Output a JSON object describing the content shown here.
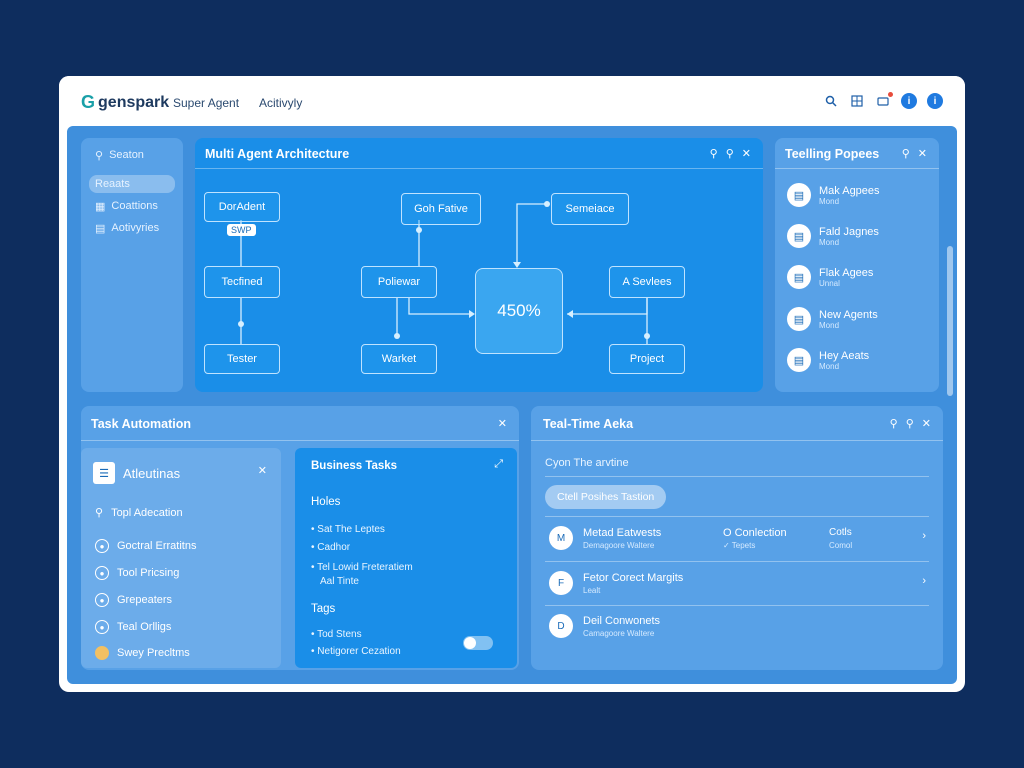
{
  "topbar": {
    "brand": "genspark",
    "brand_icon": "G",
    "nav": [
      "Super Agent",
      "Acitivyly"
    ],
    "icons": [
      "search-icon",
      "grid-icon",
      "notification-icon",
      "info-icon",
      "info-icon"
    ]
  },
  "sidebar": {
    "items": [
      {
        "label": "Seaton",
        "icon": "link-icon"
      },
      {
        "label": "Reaats",
        "icon": "none"
      },
      {
        "label": "Coattions",
        "icon": "grid-icon"
      },
      {
        "label": "Aotivyries",
        "icon": "chart-icon"
      }
    ]
  },
  "diagram": {
    "title": "Multi Agent Architecture",
    "nodes": {
      "dorradent": "DorAdent",
      "tag": "SWP",
      "tecfined": "Tecfined",
      "tester": "Tester",
      "goh_fative": "Goh Fative",
      "poliewar": "Poliewar",
      "warket": "Warket",
      "semeiace": "Semeiace",
      "a_sevlees": "A Sevlees",
      "project": "Project"
    },
    "hub_value": "450%"
  },
  "pages_panel": {
    "title": "Teelling Popees",
    "items": [
      {
        "title": "Mak Agpees",
        "sub": "Mond"
      },
      {
        "title": "Fald Jagnes",
        "sub": "Mond"
      },
      {
        "title": "Flak Agees",
        "sub": "Unnal"
      },
      {
        "title": "New Agents",
        "sub": "Mond"
      },
      {
        "title": "Hey Aeats",
        "sub": "Mond"
      }
    ]
  },
  "task_automation": {
    "title": "Task Automation",
    "attentions_title": "Atleutinas",
    "items": [
      {
        "label": "Topl Adecation",
        "icon": "search-icon"
      },
      {
        "label": "Goctral Erratitns",
        "icon": "circle-icon"
      },
      {
        "label": "Tool Pricsing",
        "icon": "circle-icon"
      },
      {
        "label": "Grepeaters",
        "icon": "circle-icon"
      },
      {
        "label": "Teal Orlligs",
        "icon": "circle-icon"
      },
      {
        "label": "Swey Precltms",
        "icon": "avatar-icon"
      }
    ],
    "business_tasks": {
      "title": "Business Tasks",
      "holes_heading": "Holes",
      "holes": [
        "Sat The Leptes",
        "Cadhor",
        "Tel Lowid Freteratiem",
        "Aal Tinte"
      ],
      "tags_heading": "Tags",
      "tags": [
        "Tod Stens",
        "Netigorer Cezation"
      ]
    }
  },
  "realtime": {
    "title": "Teal-Time Aeka",
    "input_placeholder": "Cyon The arvtine",
    "button": "Ctell Posihes Tastion",
    "rows": [
      {
        "icon": "M",
        "title": "Metad Eatwests",
        "sub": "Demagoore Waltere",
        "c2": "O Conlection",
        "c2s": "✓ Tepets",
        "c3": "Cotls",
        "c3s": "Comol"
      },
      {
        "icon": "F",
        "title": "Fetor Corect Margits",
        "sub": "Lealt",
        "c2": "",
        "c2s": "",
        "c3": "",
        "c3s": ""
      },
      {
        "icon": "D",
        "title": "Deil Conwonets",
        "sub": "Camagoore Waltere",
        "c2": "",
        "c2s": "",
        "c3": "",
        "c3s": ""
      }
    ]
  },
  "colors": {
    "background": "#0e2d5e",
    "canvas": "#3f8fdc",
    "accent": "#1a8ee8"
  }
}
